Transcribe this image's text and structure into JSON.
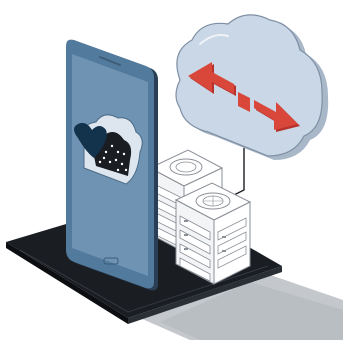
{
  "scene": {
    "subject": "cloud-sync-illustration",
    "icons": [
      "smartphone-icon",
      "heart-cloud-icon",
      "cloud-icon",
      "sync-arrows-icon",
      "server-rack-icon"
    ]
  },
  "colors": {
    "background": "#ffffff",
    "platform_top": "#1a1d22",
    "platform_side": "#0c0e11",
    "shadow": "#bfc2c6",
    "phone_body": "#527a9c",
    "phone_screen": "#6f93b3",
    "phone_edge": "#2a3f55",
    "cloud_fill": "#c9d7e6",
    "cloud_stroke": "#7f8fa3",
    "arrow_red": "#d9473b",
    "heart_navy": "#13324c",
    "server_fill": "#ffffff",
    "server_stroke": "#8a8f96"
  }
}
